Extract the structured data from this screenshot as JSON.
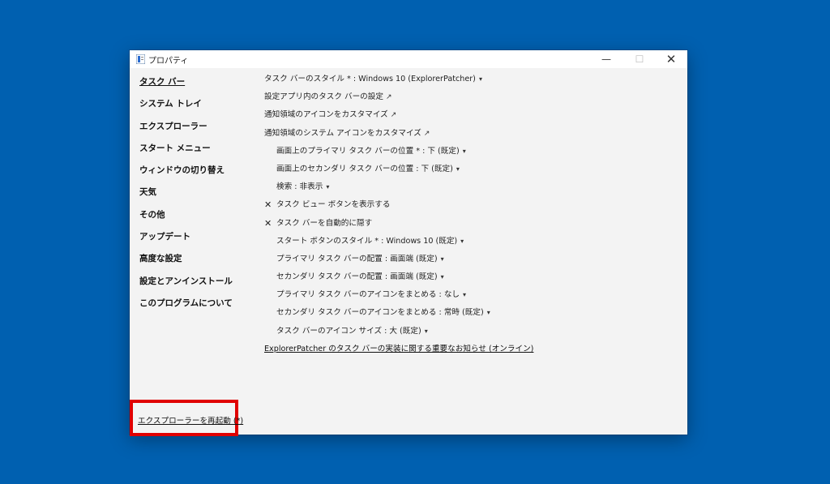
{
  "window": {
    "title": "プロパティ",
    "minimize_glyph": "—",
    "maximize_glyph": "☐",
    "close_glyph": "✕"
  },
  "sidebar": {
    "items": [
      {
        "label": "タスク バー",
        "active": true
      },
      {
        "label": "システム トレイ"
      },
      {
        "label": "エクスプローラー"
      },
      {
        "label": "スタート メニュー"
      },
      {
        "label": "ウィンドウの切り替え"
      },
      {
        "label": "天気"
      },
      {
        "label": "その他"
      },
      {
        "label": "アップデート"
      },
      {
        "label": "高度な設定"
      },
      {
        "label": "設定とアンインストール"
      },
      {
        "label": "このプログラムについて"
      }
    ],
    "restart_link": "エクスプローラーを再起動 (*)"
  },
  "settings": [
    {
      "label": "タスク バーのスタイル * : Windows 10 (ExplorerPatcher)",
      "type": "dropdown",
      "arrow": "▾"
    },
    {
      "label": "設定アプリ内のタスク バーの設定",
      "type": "external",
      "ext": "↗"
    },
    {
      "label": "通知領域のアイコンをカスタマイズ",
      "type": "external",
      "ext": "↗"
    },
    {
      "label": "通知領域のシステム アイコンをカスタマイズ",
      "type": "external",
      "ext": "↗"
    },
    {
      "label": "画面上のプライマリ タスク バーの位置 * : 下 (既定)",
      "type": "dropdown",
      "indent": true,
      "arrow": "▾"
    },
    {
      "label": "画面上のセカンダリ タスク バーの位置 : 下 (既定)",
      "type": "dropdown",
      "indent": true,
      "arrow": "▾"
    },
    {
      "label": "検索 : 非表示",
      "type": "dropdown",
      "indent": true,
      "arrow": "▾"
    },
    {
      "label": "タスク ビュー ボタンを表示する",
      "type": "checkbox",
      "checked": true,
      "mark": "✕"
    },
    {
      "label": "タスク バーを自動的に隠す",
      "type": "checkbox",
      "checked": true,
      "mark": "✕"
    },
    {
      "label": "スタート ボタンのスタイル * : Windows 10 (既定)",
      "type": "dropdown",
      "indent": true,
      "arrow": "▾"
    },
    {
      "label": "プライマリ タスク バーの配置 : 画面端 (既定)",
      "type": "dropdown",
      "indent": true,
      "arrow": "▾"
    },
    {
      "label": "セカンダリ タスク バーの配置 : 画面端 (既定)",
      "type": "dropdown",
      "indent": true,
      "arrow": "▾"
    },
    {
      "label": "プライマリ タスク バーのアイコンをまとめる : なし",
      "type": "dropdown",
      "indent": true,
      "arrow": "▾"
    },
    {
      "label": "セカンダリ タスク バーのアイコンをまとめる : 常時 (既定)",
      "type": "dropdown",
      "indent": true,
      "arrow": "▾"
    },
    {
      "label": "タスク バーのアイコン サイズ : 大 (既定)",
      "type": "dropdown",
      "indent": true,
      "arrow": "▾"
    },
    {
      "label": "ExplorerPatcher のタスク バーの実装に関する重要なお知らせ (オンライン)",
      "type": "link"
    }
  ],
  "colors": {
    "desktop": "#0060b0",
    "highlight_box": "#e00000"
  }
}
